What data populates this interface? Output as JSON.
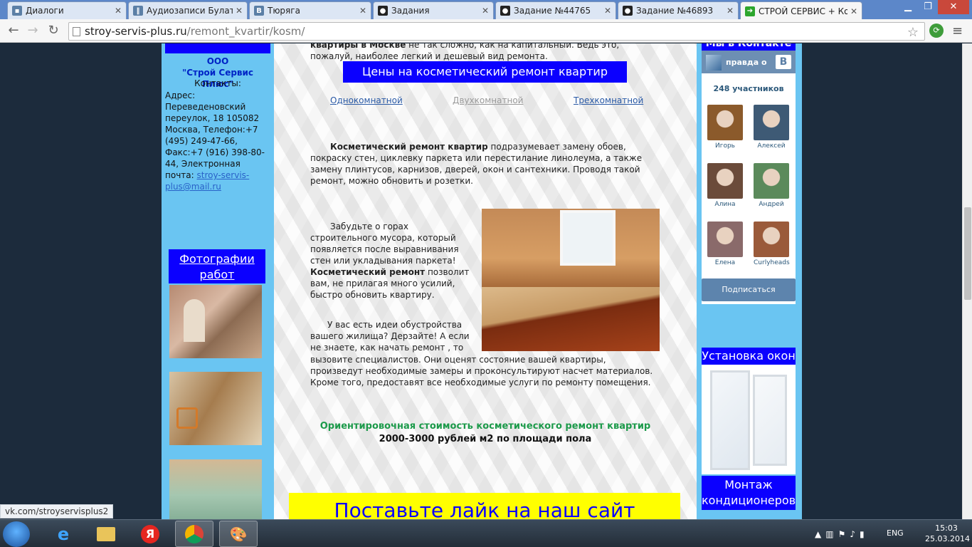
{
  "browser": {
    "tabs": [
      {
        "label": "Диалоги",
        "icon": "dialog-icon",
        "color": "#5b7fa6"
      },
      {
        "label": "Аудиозаписи Булата I",
        "icon": "pause-icon",
        "color": "#5b7fa6"
      },
      {
        "label": "Тюряга",
        "icon": "vk-icon",
        "color": "#5b7fa6"
      },
      {
        "label": "Задания",
        "icon": "circle-icon",
        "color": "#222222"
      },
      {
        "label": "Задание №44765",
        "icon": "circle-icon",
        "color": "#222222"
      },
      {
        "label": "Задание №46893",
        "icon": "circle-icon",
        "color": "#222222"
      },
      {
        "label": "СТРОЙ СЕРВИС + Ко",
        "icon": "arrow-icon",
        "color": "#2da62d"
      }
    ],
    "url_host": "stroy-servis-plus.ru",
    "url_path": "/remont_kvartir/kosm/",
    "status_url": "vk.com/stroyservisplus2"
  },
  "left": {
    "company_line1": "ООО",
    "company_line2": "\"Строй Сервис Плюс\"",
    "contacts_title": "Контакты:",
    "address": "Адрес: Переведеновский переулок, 18 105082 Москва, Телефон:+7 (495) 249-47-66, Факс:+7 (916) 398-80-44, Электронная почта: ",
    "email": "stroy-servis-plus@mail.ru",
    "photos_title": "Фотографии работ"
  },
  "main": {
    "intro_bold": "квартиры в Москве",
    "intro_rest": " не так сложно, как на капитальный. Ведь это, пожалуй, наиболее легкий и дешевый вид ремонта.",
    "prices_title": "Цены на косметический ремонт квартир",
    "links": [
      "Однокомнатной",
      "Двухкомнатной ",
      "Трехкомнатной"
    ],
    "para1_bold": "Косметический ремонт квартир",
    "para1_rest": " подразумевает замену обоев, покраску стен, циклевку паркета или перестилание линолеума, а также замену плинтусов, карнизов, дверей, окон и сантехники. Проводя такой ремонт, можно обновить и розетки.",
    "para2_start": "Забудьте о горах строительного мусора, который появляется после выравнивания стен или укладывания паркета! ",
    "para2_bold": "Косметический ремонт",
    "para2_end": " позволит вам, не прилагая много усилий, быстро обновить квартиру.",
    "para3": "У вас есть идеи обустройства вашего жилища? Дерзайте! А если не знаете, как начать ремонт , то",
    "para4": "вызовите специалистов. Они оценят состояние вашей квартиры, произведут необходимые замеры и проконсультируют насчет материалов. Кроме того, предоставят все необходимые услуги по ремонту помещения.",
    "cost_title": "Ориентировочная стоимость косметического ремонт квартир",
    "cost_value": "2000-3000 рублей м2 по площади пола",
    "like_banner": "Поставьте лайк на наш сайт"
  },
  "right": {
    "vk_title": "Мы в Контакте",
    "vk_group": "правда о",
    "vk_logo": "В",
    "members_count": "248 участников",
    "members": [
      {
        "name": "Игорь",
        "color": "#8b5a2b"
      },
      {
        "name": "Алексей",
        "color": "#3e5a75"
      },
      {
        "name": "Алина",
        "color": "#6b4b3a"
      },
      {
        "name": "Андрей",
        "color": "#5b8a5b"
      },
      {
        "name": "Елена",
        "color": "#8a6a6a"
      },
      {
        "name": "Curlyheads",
        "color": "#9a5a3a"
      }
    ],
    "subscribe": "Подписаться",
    "windows_title": "Установка окон",
    "ac_title": "Монтаж кондиционеров"
  },
  "taskbar": {
    "lang": "ENG",
    "time": "15:03",
    "date": "25.03.2014"
  }
}
